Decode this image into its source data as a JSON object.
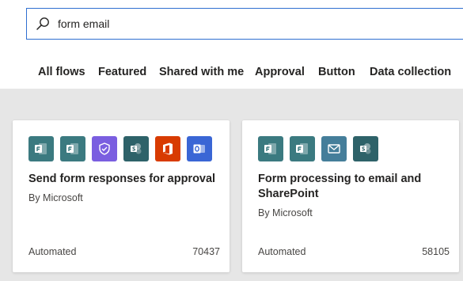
{
  "search": {
    "value": "form email",
    "placeholder": ""
  },
  "tabs": [
    {
      "label": "All flows"
    },
    {
      "label": "Featured"
    },
    {
      "label": "Shared with me"
    },
    {
      "label": "Approval"
    },
    {
      "label": "Button"
    },
    {
      "label": "Data collection"
    }
  ],
  "cards": [
    {
      "title": "Send form responses for approval",
      "author": "By Microsoft",
      "type": "Automated",
      "count": "70437",
      "icons": [
        {
          "name": "forms-icon",
          "color": "#3b7a80"
        },
        {
          "name": "forms-icon",
          "color": "#3b7a80"
        },
        {
          "name": "approvals-icon",
          "color": "#7a5ee0"
        },
        {
          "name": "sharepoint-icon",
          "color": "#2e6269"
        },
        {
          "name": "office-icon",
          "color": "#d83b01"
        },
        {
          "name": "outlook-icon",
          "color": "#3a66d5"
        }
      ]
    },
    {
      "title": "Form processing to email and SharePoint",
      "author": "By Microsoft",
      "type": "Automated",
      "count": "58105",
      "icons": [
        {
          "name": "forms-icon",
          "color": "#3b7a80"
        },
        {
          "name": "forms-icon",
          "color": "#3b7a80"
        },
        {
          "name": "mail-icon",
          "color": "#457e9a"
        },
        {
          "name": "sharepoint-icon",
          "color": "#2e6269"
        }
      ]
    }
  ]
}
